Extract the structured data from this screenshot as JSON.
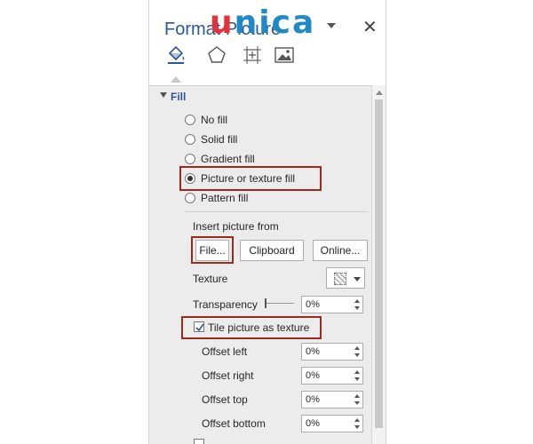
{
  "pane": {
    "title": "Format Picture",
    "watermark_u": "u",
    "watermark_rest": "nica",
    "close_glyph": "✕",
    "tabs": [
      {
        "icon": "fill-line-icon"
      },
      {
        "icon": "effects-icon"
      },
      {
        "icon": "size-properties-icon"
      },
      {
        "icon": "picture-icon"
      }
    ]
  },
  "fill": {
    "section_title": "Fill",
    "options": [
      {
        "label": "No fill",
        "checked": false
      },
      {
        "label": "Solid fill",
        "checked": false
      },
      {
        "label": "Gradient fill",
        "checked": false
      },
      {
        "label": "Picture or texture fill",
        "checked": true
      },
      {
        "label": "Pattern fill",
        "checked": false
      }
    ],
    "insert_from_label": "Insert picture from",
    "buttons": {
      "file": "File...",
      "clipboard": "Clipboard",
      "online": "Online..."
    },
    "texture_label": "Texture",
    "transparency_label": "Transparency",
    "transparency_value": "0%",
    "tile_label": "Tile picture as texture",
    "tile_checked": true,
    "offsets": [
      {
        "label": "Offset left",
        "value": "0%"
      },
      {
        "label": "Offset right",
        "value": "0%"
      },
      {
        "label": "Offset top",
        "value": "0%"
      },
      {
        "label": "Offset bottom",
        "value": "0%"
      }
    ]
  },
  "colors": {
    "accent": "#2b579a",
    "highlight": "#9e2a1e",
    "logo_red": "#e53238",
    "logo_blue": "#1e88c8"
  }
}
